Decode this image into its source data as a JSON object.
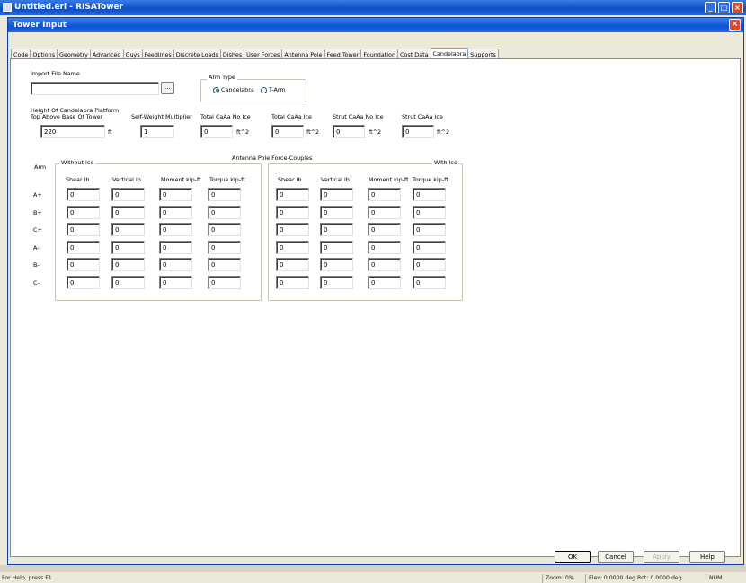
{
  "app": {
    "title": "Untitled.eri - RISATower",
    "min": "_",
    "max": "□",
    "close": "×"
  },
  "dialog": {
    "title": "Tower Input",
    "close": "×"
  },
  "tabs": [
    {
      "label": "Code"
    },
    {
      "label": "Options"
    },
    {
      "label": "Geometry"
    },
    {
      "label": "Advanced"
    },
    {
      "label": "Guys"
    },
    {
      "label": "Feedlines"
    },
    {
      "label": "Discrete Loads"
    },
    {
      "label": "Dishes"
    },
    {
      "label": "User Forces"
    },
    {
      "label": "Antenna Pole"
    },
    {
      "label": "Feed Tower"
    },
    {
      "label": "Foundation"
    },
    {
      "label": "Cost Data"
    },
    {
      "label": "Candelabra"
    },
    {
      "label": "Supports"
    }
  ],
  "active_tab": "Candelabra",
  "form": {
    "import_label": "Import File Name",
    "import_value": "",
    "browse_label": "...",
    "arm_type_label": "Arm Type",
    "arm_type_options": [
      "Candelabra",
      "T-Arm"
    ],
    "arm_type_selected": "Candelabra",
    "height_label_1": "Height Of Candelabra Platform",
    "height_label_2": "Top Above Base Of Tower",
    "height_value": "220",
    "height_unit": "ft",
    "self_weight_label": "Self-Weight Multiplier",
    "self_weight_value": "1",
    "total_no_ice_label": "Total CaAa No Ice",
    "total_no_ice_value": "0",
    "total_ice_label": "Total CaAa Ice",
    "total_ice_value": "0",
    "strut_no_ice_label": "Strut CaAa No Ice",
    "strut_no_ice_value": "0",
    "strut_ice_label": "Strut CaAa Ice",
    "strut_ice_value": "0",
    "area_unit": "ft^2"
  },
  "forces": {
    "title": "Antenna Pole Force-Couples",
    "arm_header": "Arm",
    "without_ice_label": "Without Ice",
    "with_ice_label": "With Ice",
    "columns": [
      "Shear  lb",
      "Vertical  lb",
      "Moment  kip-ft",
      "Torque  kip-ft"
    ],
    "rows": [
      {
        "arm": "A+",
        "without": [
          "0",
          "0",
          "0",
          "0"
        ],
        "with": [
          "0",
          "0",
          "0",
          "0"
        ]
      },
      {
        "arm": "B+",
        "without": [
          "0",
          "0",
          "0",
          "0"
        ],
        "with": [
          "0",
          "0",
          "0",
          "0"
        ]
      },
      {
        "arm": "C+",
        "without": [
          "0",
          "0",
          "0",
          "0"
        ],
        "with": [
          "0",
          "0",
          "0",
          "0"
        ]
      },
      {
        "arm": "A-",
        "without": [
          "0",
          "0",
          "0",
          "0"
        ],
        "with": [
          "0",
          "0",
          "0",
          "0"
        ]
      },
      {
        "arm": "B-",
        "without": [
          "0",
          "0",
          "0",
          "0"
        ],
        "with": [
          "0",
          "0",
          "0",
          "0"
        ]
      },
      {
        "arm": "C-",
        "without": [
          "0",
          "0",
          "0",
          "0"
        ],
        "with": [
          "0",
          "0",
          "0",
          "0"
        ]
      }
    ]
  },
  "buttons": {
    "ok": "OK",
    "cancel": "Cancel",
    "apply": "Apply",
    "help": "Help"
  },
  "status": {
    "help_text": "For Help, press F1",
    "zoom": "Zoom: 0%",
    "elev": "Elev: 0.0000 deg  Rot: 0.0000 deg",
    "num": "NUM"
  }
}
